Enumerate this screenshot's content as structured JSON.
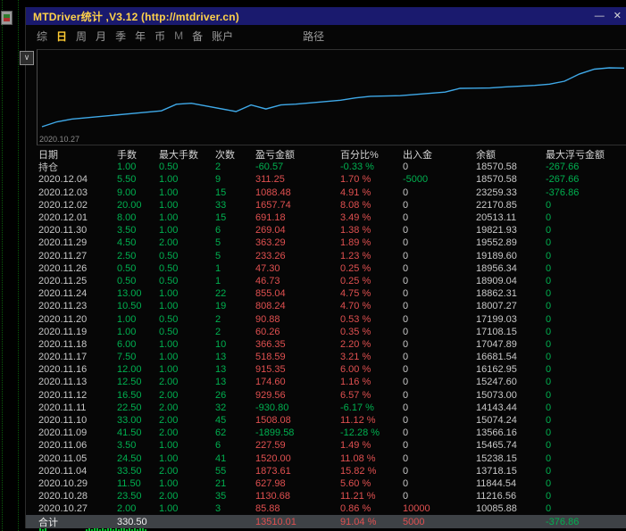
{
  "window": {
    "title": "MTDriver统计 ,V3.12 (http://mtdriver.cn)",
    "controls": {
      "minimize": "—",
      "close": "✕"
    },
    "collapse_arrow": "∨"
  },
  "menu": {
    "items": [
      {
        "key": "summary",
        "label": "综"
      },
      {
        "key": "daily",
        "label": "日",
        "selected": true
      },
      {
        "key": "weekly",
        "label": "周"
      },
      {
        "key": "monthly",
        "label": "月"
      },
      {
        "key": "quarterly",
        "label": "季"
      },
      {
        "key": "yearly",
        "label": "年"
      },
      {
        "key": "currency",
        "label": "币"
      },
      {
        "key": "m",
        "label": "M",
        "dim": true
      },
      {
        "key": "note",
        "label": "备"
      },
      {
        "key": "account",
        "label": "账户"
      },
      {
        "key": "path",
        "label": "路径",
        "pushed": true
      }
    ]
  },
  "chart_data": {
    "type": "line",
    "title": "",
    "x_axis_start_label": "2020.10.27",
    "grid": false,
    "legend": "none",
    "ylim": [
      10000,
      23600
    ],
    "x_days": [
      0,
      1,
      2,
      8,
      9,
      10,
      13,
      14,
      15,
      16,
      17,
      20,
      21,
      22,
      23,
      24,
      27,
      28,
      29,
      30,
      31,
      33,
      34,
      35,
      36,
      37,
      38,
      39
    ],
    "series": [
      {
        "name": "equity",
        "values": [
          10085.88,
          11216.56,
          11844.54,
          13718.15,
          15238.15,
          15465.74,
          13566.16,
          15074.24,
          14143.44,
          15073.0,
          15247.6,
          16162.95,
          16681.54,
          17047.89,
          17108.15,
          17199.03,
          18007.27,
          18862.31,
          18909.04,
          18956.34,
          19189.6,
          19552.89,
          19821.93,
          20513.11,
          22170.85,
          23259.33,
          23570.58,
          23510.01
        ]
      }
    ]
  },
  "table": {
    "headers": [
      "日期",
      "手数",
      "最大手数",
      "次数",
      "盈亏金额",
      "百分比%",
      "出入金",
      "余额",
      "最大浮亏金额"
    ],
    "rows": [
      {
        "date": "持仓",
        "lots": "1.00",
        "max_lots": "0.50",
        "count": "2",
        "pl": "-60.57",
        "pct": "-0.33 %",
        "io": "0",
        "balance": "18570.58",
        "max_float": "-267.66"
      },
      {
        "date": "2020.12.04",
        "lots": "5.50",
        "max_lots": "1.00",
        "count": "9",
        "pl": "311.25",
        "pct": "1.70 %",
        "io": "-5000",
        "balance": "18570.58",
        "max_float": "-267.66"
      },
      {
        "date": "2020.12.03",
        "lots": "9.00",
        "max_lots": "1.00",
        "count": "15",
        "pl": "1088.48",
        "pct": "4.91 %",
        "io": "0",
        "balance": "23259.33",
        "max_float": "-376.86"
      },
      {
        "date": "2020.12.02",
        "lots": "20.00",
        "max_lots": "1.00",
        "count": "33",
        "pl": "1657.74",
        "pct": "8.08 %",
        "io": "0",
        "balance": "22170.85",
        "max_float": "0"
      },
      {
        "date": "2020.12.01",
        "lots": "8.00",
        "max_lots": "1.00",
        "count": "15",
        "pl": "691.18",
        "pct": "3.49 %",
        "io": "0",
        "balance": "20513.11",
        "max_float": "0"
      },
      {
        "date": "2020.11.30",
        "lots": "3.50",
        "max_lots": "1.00",
        "count": "6",
        "pl": "269.04",
        "pct": "1.38 %",
        "io": "0",
        "balance": "19821.93",
        "max_float": "0"
      },
      {
        "date": "2020.11.29",
        "lots": "4.50",
        "max_lots": "2.00",
        "count": "5",
        "pl": "363.29",
        "pct": "1.89 %",
        "io": "0",
        "balance": "19552.89",
        "max_float": "0"
      },
      {
        "date": "2020.11.27",
        "lots": "2.50",
        "max_lots": "0.50",
        "count": "5",
        "pl": "233.26",
        "pct": "1.23 %",
        "io": "0",
        "balance": "19189.60",
        "max_float": "0"
      },
      {
        "date": "2020.11.26",
        "lots": "0.50",
        "max_lots": "0.50",
        "count": "1",
        "pl": "47.30",
        "pct": "0.25 %",
        "io": "0",
        "balance": "18956.34",
        "max_float": "0"
      },
      {
        "date": "2020.11.25",
        "lots": "0.50",
        "max_lots": "0.50",
        "count": "1",
        "pl": "46.73",
        "pct": "0.25 %",
        "io": "0",
        "balance": "18909.04",
        "max_float": "0"
      },
      {
        "date": "2020.11.24",
        "lots": "13.00",
        "max_lots": "1.00",
        "count": "22",
        "pl": "855.04",
        "pct": "4.75 %",
        "io": "0",
        "balance": "18862.31",
        "max_float": "0"
      },
      {
        "date": "2020.11.23",
        "lots": "10.50",
        "max_lots": "1.00",
        "count": "19",
        "pl": "808.24",
        "pct": "4.70 %",
        "io": "0",
        "balance": "18007.27",
        "max_float": "0"
      },
      {
        "date": "2020.11.20",
        "lots": "1.00",
        "max_lots": "0.50",
        "count": "2",
        "pl": "90.88",
        "pct": "0.53 %",
        "io": "0",
        "balance": "17199.03",
        "max_float": "0"
      },
      {
        "date": "2020.11.19",
        "lots": "1.00",
        "max_lots": "0.50",
        "count": "2",
        "pl": "60.26",
        "pct": "0.35 %",
        "io": "0",
        "balance": "17108.15",
        "max_float": "0"
      },
      {
        "date": "2020.11.18",
        "lots": "6.00",
        "max_lots": "1.00",
        "count": "10",
        "pl": "366.35",
        "pct": "2.20 %",
        "io": "0",
        "balance": "17047.89",
        "max_float": "0"
      },
      {
        "date": "2020.11.17",
        "lots": "7.50",
        "max_lots": "1.00",
        "count": "13",
        "pl": "518.59",
        "pct": "3.21 %",
        "io": "0",
        "balance": "16681.54",
        "max_float": "0"
      },
      {
        "date": "2020.11.16",
        "lots": "12.00",
        "max_lots": "1.00",
        "count": "13",
        "pl": "915.35",
        "pct": "6.00 %",
        "io": "0",
        "balance": "16162.95",
        "max_float": "0"
      },
      {
        "date": "2020.11.13",
        "lots": "12.50",
        "max_lots": "2.00",
        "count": "13",
        "pl": "174.60",
        "pct": "1.16 %",
        "io": "0",
        "balance": "15247.60",
        "max_float": "0"
      },
      {
        "date": "2020.11.12",
        "lots": "16.50",
        "max_lots": "2.00",
        "count": "26",
        "pl": "929.56",
        "pct": "6.57 %",
        "io": "0",
        "balance": "15073.00",
        "max_float": "0"
      },
      {
        "date": "2020.11.11",
        "lots": "22.50",
        "max_lots": "2.00",
        "count": "32",
        "pl": "-930.80",
        "pct": "-6.17 %",
        "io": "0",
        "balance": "14143.44",
        "max_float": "0"
      },
      {
        "date": "2020.11.10",
        "lots": "33.00",
        "max_lots": "2.00",
        "count": "45",
        "pl": "1508.08",
        "pct": "11.12 %",
        "io": "0",
        "balance": "15074.24",
        "max_float": "0"
      },
      {
        "date": "2020.11.09",
        "lots": "41.50",
        "max_lots": "2.00",
        "count": "62",
        "pl": "-1899.58",
        "pct": "-12.28 %",
        "io": "0",
        "balance": "13566.16",
        "max_float": "0"
      },
      {
        "date": "2020.11.06",
        "lots": "3.50",
        "max_lots": "1.00",
        "count": "6",
        "pl": "227.59",
        "pct": "1.49 %",
        "io": "0",
        "balance": "15465.74",
        "max_float": "0"
      },
      {
        "date": "2020.11.05",
        "lots": "24.50",
        "max_lots": "1.00",
        "count": "41",
        "pl": "1520.00",
        "pct": "11.08 %",
        "io": "0",
        "balance": "15238.15",
        "max_float": "0"
      },
      {
        "date": "2020.11.04",
        "lots": "33.50",
        "max_lots": "2.00",
        "count": "55",
        "pl": "1873.61",
        "pct": "15.82 %",
        "io": "0",
        "balance": "13718.15",
        "max_float": "0"
      },
      {
        "date": "2020.10.29",
        "lots": "11.50",
        "max_lots": "1.00",
        "count": "21",
        "pl": "627.98",
        "pct": "5.60 %",
        "io": "0",
        "balance": "11844.54",
        "max_float": "0"
      },
      {
        "date": "2020.10.28",
        "lots": "23.50",
        "max_lots": "2.00",
        "count": "35",
        "pl": "1130.68",
        "pct": "11.21 %",
        "io": "0",
        "balance": "11216.56",
        "max_float": "0"
      },
      {
        "date": "2020.10.27",
        "lots": "2.00",
        "max_lots": "1.00",
        "count": "3",
        "pl": "85.88",
        "pct": "0.86 %",
        "io": "10000",
        "balance": "10085.88",
        "max_float": "0"
      }
    ],
    "total_row": {
      "date": "合计",
      "lots": "330.50",
      "max_lots": "",
      "count": "",
      "pl": "13510.01",
      "pct": "91.04 %",
      "io": "5000",
      "balance": "",
      "max_float": "-376.86"
    }
  },
  "underlay": {
    "grid_xs": [
      2,
      20
    ],
    "volume_bars": [
      [
        44,
        3
      ],
      [
        47,
        2
      ],
      [
        50,
        4
      ],
      [
        96,
        2
      ],
      [
        99,
        3
      ],
      [
        102,
        2
      ],
      [
        105,
        4
      ],
      [
        108,
        3
      ],
      [
        111,
        2
      ],
      [
        114,
        3
      ],
      [
        117,
        2
      ],
      [
        120,
        4
      ],
      [
        123,
        3
      ],
      [
        126,
        2
      ],
      [
        129,
        3
      ],
      [
        132,
        2
      ],
      [
        135,
        3
      ],
      [
        138,
        4
      ],
      [
        141,
        2
      ],
      [
        144,
        3
      ],
      [
        147,
        2
      ],
      [
        150,
        3
      ],
      [
        153,
        2
      ],
      [
        156,
        4
      ],
      [
        159,
        3
      ],
      [
        162,
        2
      ]
    ]
  },
  "colors": {
    "profit": "#e05050",
    "loss": "#00b050",
    "neutral": "#c8c8c8",
    "title_text": "#ffd24a",
    "titlebar_bg": "#1a1a6e",
    "menu_selected": "#ffcc33",
    "chart_line": "#3fa9e8",
    "grid_green": "#0b5d0b",
    "total_row_bg": "#3e4246"
  }
}
